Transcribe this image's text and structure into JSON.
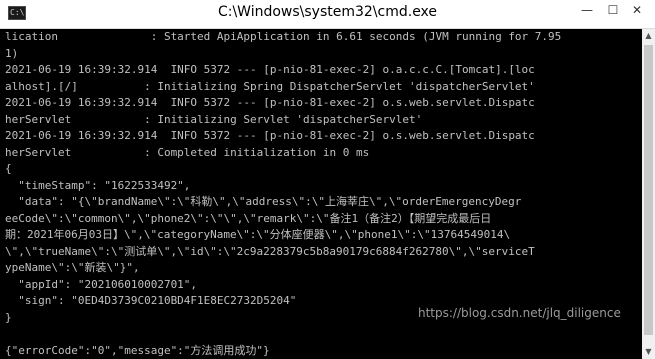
{
  "window": {
    "title": "C:\\Windows\\system32\\cmd.exe",
    "icon_text": "C:\\",
    "controls": {
      "minimize": "—",
      "maximize": "☐",
      "close": "✕"
    }
  },
  "console": {
    "lines": [
      "lication              : Started ApiApplication in 6.61 seconds (JVM running for 7.95",
      "1)",
      "2021-06-19 16:39:32.914  INFO 5372 --- [p-nio-81-exec-2] o.a.c.c.C.[Tomcat].[loc",
      "alhost].[/]          : Initializing Spring DispatcherServlet 'dispatcherServlet'",
      "2021-06-19 16:39:32.914  INFO 5372 --- [p-nio-81-exec-2] o.s.web.servlet.Dispatc",
      "herServlet           : Initializing Servlet 'dispatcherServlet'",
      "2021-06-19 16:39:32.914  INFO 5372 --- [p-nio-81-exec-2] o.s.web.servlet.Dispatc",
      "herServlet           : Completed initialization in 0 ms",
      "{",
      "  \"timeStamp\": \"1622533492\",",
      "  \"data\": \"{\\\"brandName\\\":\\\"科勒\\\",\\\"address\\\":\\\"上海莘庄\\\",\\\"orderEmergencyDegr",
      "eeCode\\\":\\\"common\\\",\\\"phone2\\\":\\\"\\\",\\\"remark\\\":\\\"备注1（备注2）【期望完成最后日",
      "期：2021年06月03日】\\\",\\\"categoryName\\\":\\\"分体座便器\\\",\\\"phone1\\\":\\\"13764549014\\",
      "\\\",\\\"trueName\\\":\\\"测试单\\\",\\\"id\\\":\\\"2c9a228379c5b8a90179c6884f262780\\\",\\\"serviceT",
      "ypeName\\\":\\\"新装\\\"}\",",
      "  \"appId\": \"202106010002701\",",
      "  \"sign\": \"0ED4D3739C0210BD4F1E8EC2732D5204\"",
      "}",
      "",
      "{\"errorCode\":\"0\",\"message\":\"方法调用成功\"}"
    ]
  },
  "scrollbar": {
    "up_arrow": "▲",
    "down_arrow": "▼"
  },
  "watermark": "https://blog.csdn.net/jlq_diligence"
}
